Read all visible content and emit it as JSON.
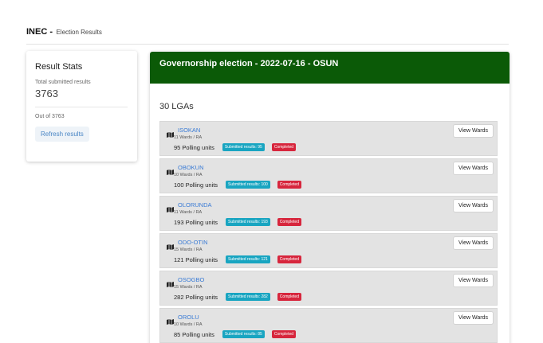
{
  "header": {
    "brand": "INEC -",
    "subtitle": "Election Results"
  },
  "stats": {
    "title": "Result Stats",
    "total_label": "Total submitted results",
    "total_value": "3763",
    "out_of": "Out of 3763",
    "refresh_label": "Refresh results"
  },
  "election": {
    "title": "Governorship election - 2022-07-16 - OSUN",
    "lga_count": "30 LGAs"
  },
  "colors": {
    "header_green": "#0b5a07",
    "link_blue": "#3a7bd5",
    "badge_cyan": "#19a5c1",
    "badge_red": "#d7263d"
  },
  "lgas": [
    {
      "name": "ISOKAN",
      "wards": "11 Wards / RA",
      "units": "95 Polling units",
      "submitted": "Submitted results: 95",
      "status": "Completed",
      "action": "View Wards",
      "icon": "map-icon"
    },
    {
      "name": "OBOKUN",
      "wards": "10 Wards / RA",
      "units": "100 Polling units",
      "submitted": "Submitted results: 100",
      "status": "Completed",
      "action": "View Wards",
      "icon": "map-icon"
    },
    {
      "name": "OLORUNDA",
      "wards": "11 Wards / RA",
      "units": "193 Polling units",
      "submitted": "Submitted results: 193",
      "status": "Completed",
      "action": "View Wards",
      "icon": "map-icon"
    },
    {
      "name": "ODO-OTIN",
      "wards": "15 Wards / RA",
      "units": "121 Polling units",
      "submitted": "Submitted results: 121",
      "status": "Completed",
      "action": "View Wards",
      "icon": "map-icon"
    },
    {
      "name": "OSOGBO",
      "wards": "15 Wards / RA",
      "units": "282 Polling units",
      "submitted": "Submitted results: 282",
      "status": "Completed",
      "action": "View Wards",
      "icon": "map-icon"
    },
    {
      "name": "OROLU",
      "wards": "10 Wards / RA",
      "units": "85 Polling units",
      "submitted": "Submitted results: 85",
      "status": "Completed",
      "action": "View Wards",
      "icon": "map-icon"
    }
  ]
}
